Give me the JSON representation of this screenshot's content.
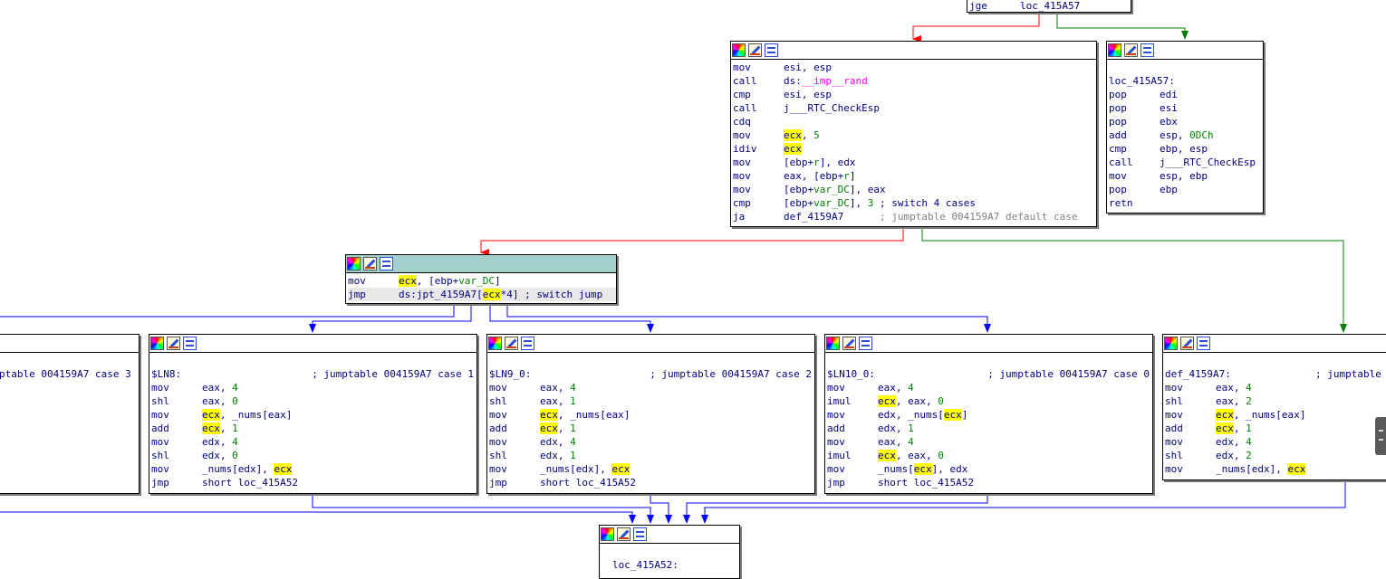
{
  "graph": {
    "top_block": {
      "mnemonic": "jge",
      "operand": "loc_415A57"
    },
    "rand_block": {
      "lines": [
        {
          "mn": "mov",
          "op": [
            {
              "t": "esi, esp"
            }
          ]
        },
        {
          "mn": "call",
          "op": [
            {
              "t": "ds:"
            },
            {
              "t": "__imp__rand",
              "c": "imp"
            }
          ]
        },
        {
          "mn": "cmp",
          "op": [
            {
              "t": "esi, esp"
            }
          ]
        },
        {
          "mn": "call",
          "op": [
            {
              "t": "j___RTC_CheckEsp"
            }
          ]
        },
        {
          "mn": "cdq",
          "op": []
        },
        {
          "mn": "mov",
          "op": [
            {
              "t": "ecx",
              "c": "reg-hl"
            },
            {
              "t": ", "
            },
            {
              "t": "5",
              "c": "num"
            }
          ]
        },
        {
          "mn": "idiv",
          "op": [
            {
              "t": "ecx",
              "c": "reg-hl"
            }
          ]
        },
        {
          "mn": "mov",
          "op": [
            {
              "t": "[ebp+"
            },
            {
              "t": "r",
              "c": "var"
            },
            {
              "t": "], edx"
            }
          ]
        },
        {
          "mn": "mov",
          "op": [
            {
              "t": "eax, [ebp+"
            },
            {
              "t": "r",
              "c": "var"
            },
            {
              "t": "]"
            }
          ]
        },
        {
          "mn": "mov",
          "op": [
            {
              "t": "[ebp+"
            },
            {
              "t": "var_DC",
              "c": "var"
            },
            {
              "t": "], eax"
            }
          ]
        },
        {
          "mn": "cmp",
          "op": [
            {
              "t": "[ebp+"
            },
            {
              "t": "var_DC",
              "c": "var"
            },
            {
              "t": "], "
            },
            {
              "t": "3",
              "c": "num"
            },
            {
              "t": " ; switch 4 cases",
              "c": "cm"
            }
          ]
        },
        {
          "mn": "ja",
          "op": [
            {
              "t": "def_4159A7      "
            },
            {
              "t": "; jumptable 004159A7 default case",
              "c": "cm-grey"
            }
          ]
        }
      ]
    },
    "loc_415A57_block": {
      "label": "loc_415A57:",
      "lines": [
        {
          "mn": "pop",
          "op": [
            {
              "t": "edi"
            }
          ]
        },
        {
          "mn": "pop",
          "op": [
            {
              "t": "esi"
            }
          ]
        },
        {
          "mn": "pop",
          "op": [
            {
              "t": "ebx"
            }
          ]
        },
        {
          "mn": "add",
          "op": [
            {
              "t": "esp, "
            },
            {
              "t": "0DCh",
              "c": "num"
            }
          ]
        },
        {
          "mn": "cmp",
          "op": [
            {
              "t": "ebp, esp"
            }
          ]
        },
        {
          "mn": "call",
          "op": [
            {
              "t": "j___RTC_CheckEsp"
            }
          ]
        },
        {
          "mn": "mov",
          "op": [
            {
              "t": "esp, ebp"
            }
          ]
        },
        {
          "mn": "pop",
          "op": [
            {
              "t": "ebp"
            }
          ]
        },
        {
          "mn": "retn",
          "op": []
        }
      ]
    },
    "switch_block": {
      "lines": [
        {
          "mn": "mov",
          "op": [
            {
              "t": "ecx",
              "c": "reg-hl"
            },
            {
              "t": ", [ebp+"
            },
            {
              "t": "var_DC",
              "c": "var"
            },
            {
              "t": "]"
            }
          ]
        },
        {
          "mn": "jmp",
          "op": [
            {
              "t": "ds:jpt_4159A7["
            },
            {
              "t": "ecx",
              "c": "reg-hl"
            },
            {
              "t": "*4] "
            },
            {
              "t": "; switch jump",
              "c": "cm"
            }
          ]
        }
      ]
    },
    "case3_block": {
      "label": "ptable 004159A7 case 3"
    },
    "case1_block": {
      "label": "$LN8:",
      "comment": "; jumptable 004159A7 case 1",
      "lines": [
        {
          "mn": "mov",
          "op": [
            {
              "t": "eax, "
            },
            {
              "t": "4",
              "c": "num"
            }
          ]
        },
        {
          "mn": "shl",
          "op": [
            {
              "t": "eax, "
            },
            {
              "t": "0",
              "c": "num"
            }
          ]
        },
        {
          "mn": "mov",
          "op": [
            {
              "t": "ecx",
              "c": "reg-hl"
            },
            {
              "t": ", _nums[eax]"
            }
          ]
        },
        {
          "mn": "add",
          "op": [
            {
              "t": "ecx",
              "c": "reg-hl"
            },
            {
              "t": ", "
            },
            {
              "t": "1",
              "c": "num"
            }
          ]
        },
        {
          "mn": "mov",
          "op": [
            {
              "t": "edx, "
            },
            {
              "t": "4",
              "c": "num"
            }
          ]
        },
        {
          "mn": "shl",
          "op": [
            {
              "t": "edx, "
            },
            {
              "t": "0",
              "c": "num"
            }
          ]
        },
        {
          "mn": "mov",
          "op": [
            {
              "t": "_nums[edx], "
            },
            {
              "t": "ecx",
              "c": "reg-hl"
            }
          ]
        },
        {
          "mn": "jmp",
          "op": [
            {
              "t": "short loc_415A52"
            }
          ]
        }
      ]
    },
    "case2_block": {
      "label": "$LN9_0:",
      "comment": "; jumptable 004159A7 case 2",
      "lines": [
        {
          "mn": "mov",
          "op": [
            {
              "t": "eax, "
            },
            {
              "t": "4",
              "c": "num"
            }
          ]
        },
        {
          "mn": "shl",
          "op": [
            {
              "t": "eax, "
            },
            {
              "t": "1",
              "c": "num"
            }
          ]
        },
        {
          "mn": "mov",
          "op": [
            {
              "t": "ecx",
              "c": "reg-hl"
            },
            {
              "t": ", _nums[eax]"
            }
          ]
        },
        {
          "mn": "add",
          "op": [
            {
              "t": "ecx",
              "c": "reg-hl"
            },
            {
              "t": ", "
            },
            {
              "t": "1",
              "c": "num"
            }
          ]
        },
        {
          "mn": "mov",
          "op": [
            {
              "t": "edx, "
            },
            {
              "t": "4",
              "c": "num"
            }
          ]
        },
        {
          "mn": "shl",
          "op": [
            {
              "t": "edx, "
            },
            {
              "t": "1",
              "c": "num"
            }
          ]
        },
        {
          "mn": "mov",
          "op": [
            {
              "t": "_nums[edx], "
            },
            {
              "t": "ecx",
              "c": "reg-hl"
            }
          ]
        },
        {
          "mn": "jmp",
          "op": [
            {
              "t": "short loc_415A52"
            }
          ]
        }
      ]
    },
    "case0_block": {
      "label": "$LN10_0:",
      "comment": "; jumptable 004159A7 case 0",
      "lines": [
        {
          "mn": "mov",
          "op": [
            {
              "t": "eax, "
            },
            {
              "t": "4",
              "c": "num"
            }
          ]
        },
        {
          "mn": "imul",
          "op": [
            {
              "t": "ecx",
              "c": "reg-hl"
            },
            {
              "t": ", eax, "
            },
            {
              "t": "0",
              "c": "num"
            }
          ]
        },
        {
          "mn": "mov",
          "op": [
            {
              "t": "edx, _nums["
            },
            {
              "t": "ecx",
              "c": "reg-hl"
            },
            {
              "t": "]"
            }
          ]
        },
        {
          "mn": "add",
          "op": [
            {
              "t": "edx, "
            },
            {
              "t": "1",
              "c": "num"
            }
          ]
        },
        {
          "mn": "mov",
          "op": [
            {
              "t": "eax, "
            },
            {
              "t": "4",
              "c": "num"
            }
          ]
        },
        {
          "mn": "imul",
          "op": [
            {
              "t": "ecx",
              "c": "reg-hl"
            },
            {
              "t": ", eax, "
            },
            {
              "t": "0",
              "c": "num"
            }
          ]
        },
        {
          "mn": "mov",
          "op": [
            {
              "t": "_nums["
            },
            {
              "t": "ecx",
              "c": "reg-hl"
            },
            {
              "t": "], edx"
            }
          ]
        },
        {
          "mn": "jmp",
          "op": [
            {
              "t": "short loc_415A52"
            }
          ]
        }
      ]
    },
    "default_block": {
      "label": "def_4159A7:",
      "comment": "; jumptable",
      "lines": [
        {
          "mn": "mov",
          "op": [
            {
              "t": "eax, "
            },
            {
              "t": "4",
              "c": "num"
            }
          ]
        },
        {
          "mn": "shl",
          "op": [
            {
              "t": "eax, "
            },
            {
              "t": "2",
              "c": "num"
            }
          ]
        },
        {
          "mn": "mov",
          "op": [
            {
              "t": "ecx",
              "c": "reg-hl"
            },
            {
              "t": ", _nums[eax]"
            }
          ]
        },
        {
          "mn": "add",
          "op": [
            {
              "t": "ecx",
              "c": "reg-hl"
            },
            {
              "t": ", "
            },
            {
              "t": "1",
              "c": "num"
            }
          ]
        },
        {
          "mn": "mov",
          "op": [
            {
              "t": "edx, "
            },
            {
              "t": "4",
              "c": "num"
            }
          ]
        },
        {
          "mn": "shl",
          "op": [
            {
              "t": "edx, "
            },
            {
              "t": "2",
              "c": "num"
            }
          ]
        },
        {
          "mn": "mov",
          "op": [
            {
              "t": "_nums[edx], "
            },
            {
              "t": "ecx",
              "c": "reg-hl"
            }
          ]
        }
      ]
    },
    "join_block": {
      "label": "loc_415A52:"
    }
  },
  "colors": {
    "true_edge": "#008000",
    "false_edge": "#ff0000",
    "uncond_edge": "#0000ff",
    "selected_header": "#a4d0cc",
    "register_highlight": "#ffff00"
  },
  "icons": [
    "color-palette-icon",
    "edit-node-icon",
    "graph-view-icon"
  ]
}
